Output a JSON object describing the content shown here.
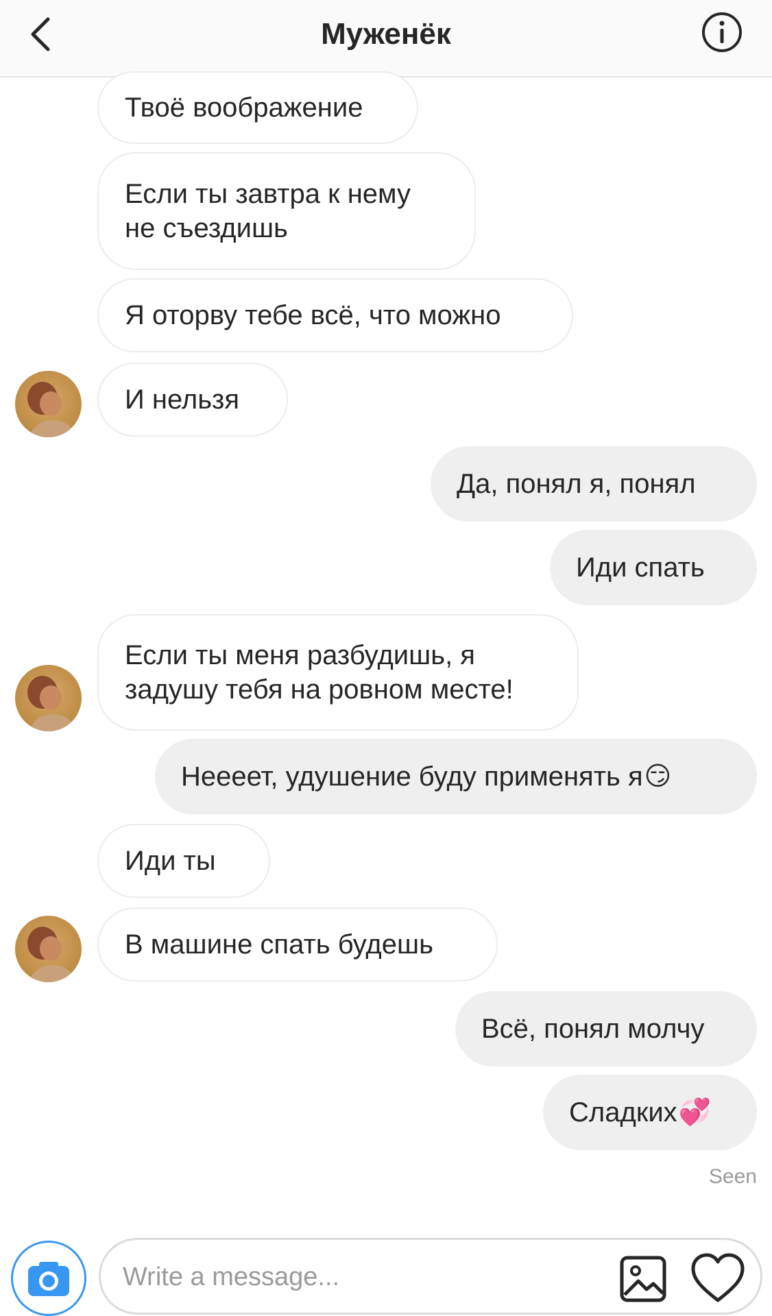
{
  "header": {
    "title": "Муженёк",
    "back_icon": "chevron-left-icon",
    "info_icon": "info-icon"
  },
  "messages": [
    {
      "direction": "incoming",
      "text": "Твоё воображение"
    },
    {
      "direction": "incoming",
      "text": "Если ты завтра к нему\nне съездишь"
    },
    {
      "direction": "incoming",
      "text": "Я оторву тебе всё, что можно"
    },
    {
      "direction": "incoming",
      "text": "И нельзя"
    },
    {
      "direction": "outgoing",
      "text": "Да, понял я, понял"
    },
    {
      "direction": "outgoing",
      "text": "Иди спать"
    },
    {
      "direction": "incoming",
      "text": "Если ты меня разбудишь, я\nзадушу тебя на ровном месте!"
    },
    {
      "direction": "outgoing",
      "text": "Нееeет, удушение буду применять я",
      "emoji": "😏"
    },
    {
      "direction": "incoming",
      "text": "Иди ты"
    },
    {
      "direction": "incoming",
      "text": "В машине спать будешь"
    },
    {
      "direction": "outgoing",
      "text": "Всё, понял молчу"
    },
    {
      "direction": "outgoing",
      "text": "Сладких",
      "emoji": "💞"
    }
  ],
  "status": {
    "seen": "Seen"
  },
  "composer": {
    "placeholder": "Write a message...",
    "camera_icon": "camera-icon",
    "gallery_icon": "image-icon",
    "like_icon": "heart-icon"
  },
  "colors": {
    "accent": "#3897f0",
    "outgoing_bubble": "#efeff0",
    "incoming_border": "#ececec"
  }
}
